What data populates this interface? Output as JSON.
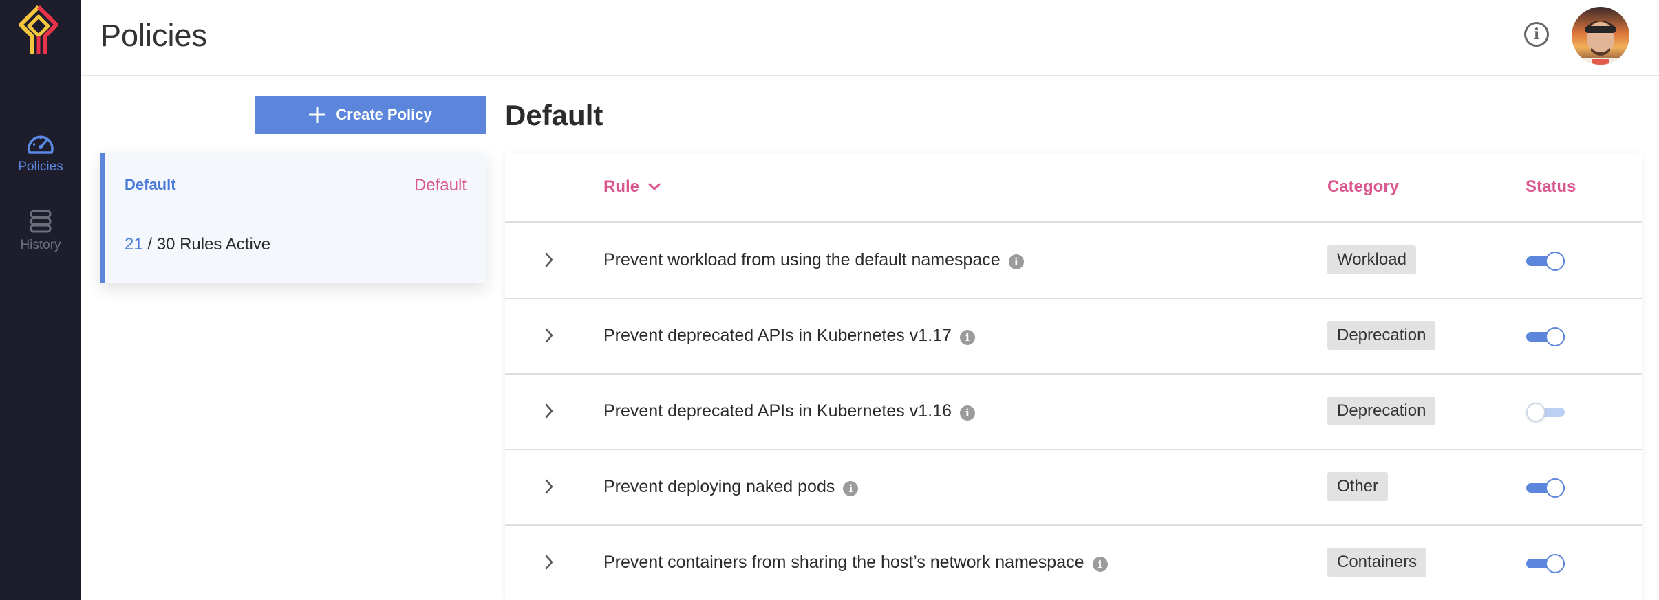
{
  "app": {
    "brand_colors": {
      "sidebar_bg": "#1e1d2c",
      "accent": "#5b86dc",
      "pink": "#d9578f",
      "logo_yellow": "#f4c63d",
      "logo_red": "#e8334b"
    }
  },
  "sidebar": {
    "items": [
      {
        "label": "Policies",
        "icon": "dashboard-gauge-icon",
        "active": true
      },
      {
        "label": "History",
        "icon": "database-stack-icon",
        "active": false
      }
    ]
  },
  "header": {
    "title": "Policies",
    "info_icon": "info-icon",
    "avatar_icon": "user-avatar",
    "menu_icon": "chevron-down-icon"
  },
  "create_policy": {
    "label": "Create Policy",
    "icon": "plus-icon"
  },
  "policy_card": {
    "name": "Default",
    "tag": "Default",
    "active_rules": "21",
    "rules_suffix": " / 30 Rules Active"
  },
  "main": {
    "title": "Default",
    "columns": {
      "rule": "Rule",
      "category": "Category",
      "status": "Status"
    },
    "rows": [
      {
        "rule": "Prevent workload from using the default namespace",
        "category": "Workload",
        "enabled": true
      },
      {
        "rule": "Prevent deprecated APIs in Kubernetes v1.17",
        "category": "Deprecation",
        "enabled": true
      },
      {
        "rule": "Prevent deprecated APIs in Kubernetes v1.16",
        "category": "Deprecation",
        "enabled": false
      },
      {
        "rule": "Prevent deploying naked pods",
        "category": "Other",
        "enabled": true
      },
      {
        "rule": "Prevent containers from sharing the host’s network namespace",
        "category": "Containers",
        "enabled": true
      }
    ],
    "info_glyph": "i"
  }
}
